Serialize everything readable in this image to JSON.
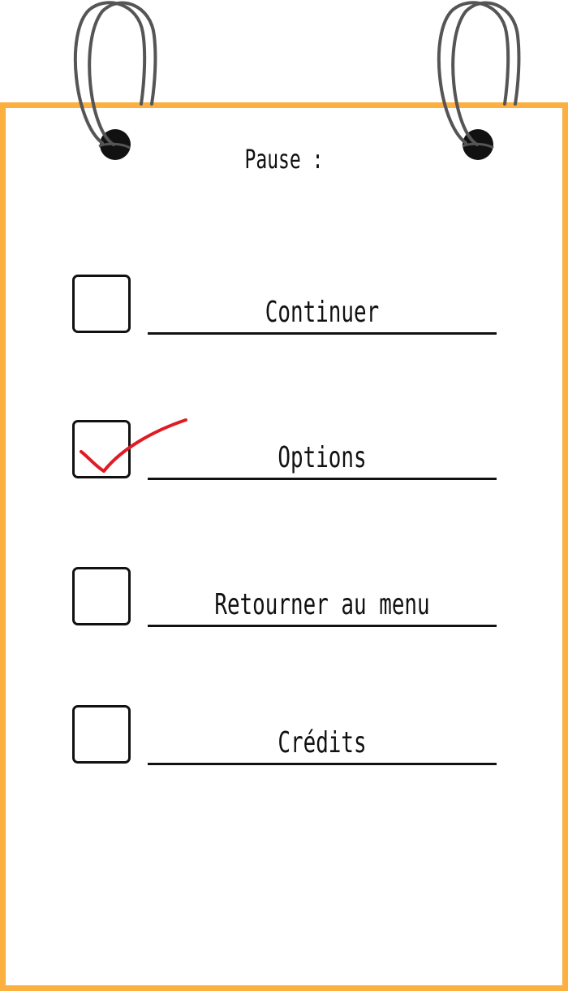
{
  "menu": {
    "title": "Pause :",
    "items": [
      {
        "id": "continuer",
        "label": "Continuer",
        "checked": false
      },
      {
        "id": "options",
        "label": "Options",
        "checked": true
      },
      {
        "id": "retourner",
        "label": "Retourner au menu",
        "checked": false
      },
      {
        "id": "credits",
        "label": "Crédits",
        "checked": false
      }
    ]
  },
  "colors": {
    "border": "#fbb040",
    "ink": "#111111",
    "check": "#e01b24",
    "ring": "#555555"
  },
  "icons": {
    "ring": "binder-ring-icon",
    "hole": "punch-hole-icon",
    "check": "red-checkmark-icon"
  }
}
